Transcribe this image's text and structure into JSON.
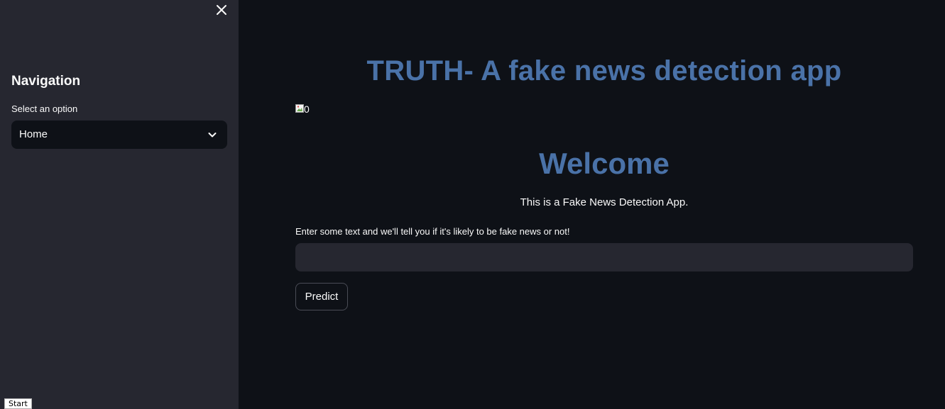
{
  "sidebar": {
    "title": "Navigation",
    "select_label": "Select an option",
    "select_value": "Home"
  },
  "main": {
    "title": "TRUTH- A fake news detection app",
    "image_alt": "0",
    "welcome": "Welcome",
    "intro": "This is a Fake News Detection App.",
    "input_label": "Enter some text and we'll tell you if it's likely to be fake news or not!",
    "input_value": "",
    "predict_label": "Predict"
  },
  "footer": {
    "start_label": "Start"
  },
  "colors": {
    "background": "#0e1117",
    "sidebar": "#262730",
    "heading": "#4a72a8",
    "text": "#fafafa"
  },
  "icons": {
    "close": "close-icon",
    "chevron": "chevron-down-icon",
    "broken_image": "broken-image-icon"
  }
}
